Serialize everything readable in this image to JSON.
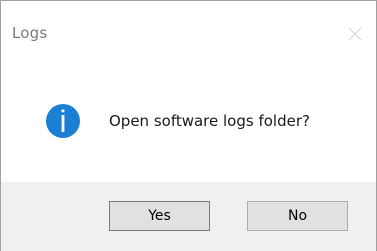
{
  "dialog": {
    "title": "Logs",
    "message": "Open software logs folder?",
    "icon": "info-icon",
    "buttons": {
      "yes_label": "Yes",
      "no_label": "No"
    },
    "colors": {
      "icon_blue": "#1b7fd4",
      "footer_bg": "#f0f0f0",
      "button_bg": "#e1e1e1"
    }
  }
}
